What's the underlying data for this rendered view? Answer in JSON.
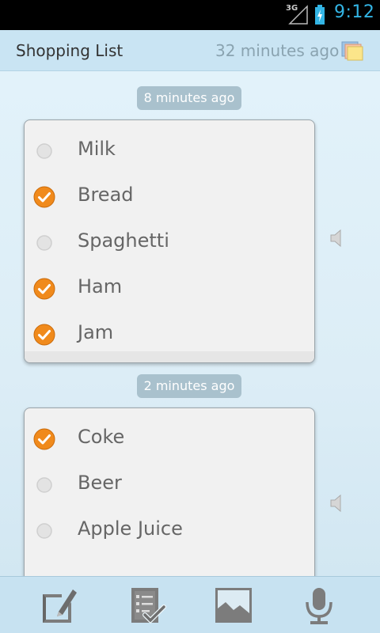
{
  "status_bar": {
    "network": "3G",
    "time": "9:12"
  },
  "header": {
    "title": "Shopping List",
    "updated": "32 minutes ago",
    "icon": "notes-icon"
  },
  "groups": [
    {
      "time": "8 minutes ago",
      "items": [
        {
          "label": "Milk",
          "checked": false
        },
        {
          "label": "Bread",
          "checked": true
        },
        {
          "label": "Spaghetti",
          "checked": false
        },
        {
          "label": "Ham",
          "checked": true
        },
        {
          "label": "Jam",
          "checked": true
        }
      ]
    },
    {
      "time": "2 minutes ago",
      "items": [
        {
          "label": "Coke",
          "checked": true
        },
        {
          "label": "Beer",
          "checked": false
        },
        {
          "label": "Apple Juice",
          "checked": false
        }
      ]
    }
  ],
  "toolbar": {
    "buttons": [
      "edit-note-icon",
      "checklist-icon",
      "image-icon",
      "microphone-icon"
    ]
  },
  "colors": {
    "accent": "#33b5e5",
    "check": "#f08a1c",
    "header_bg": "#c9e4f3",
    "pill_bg": "#a9c1cd"
  }
}
